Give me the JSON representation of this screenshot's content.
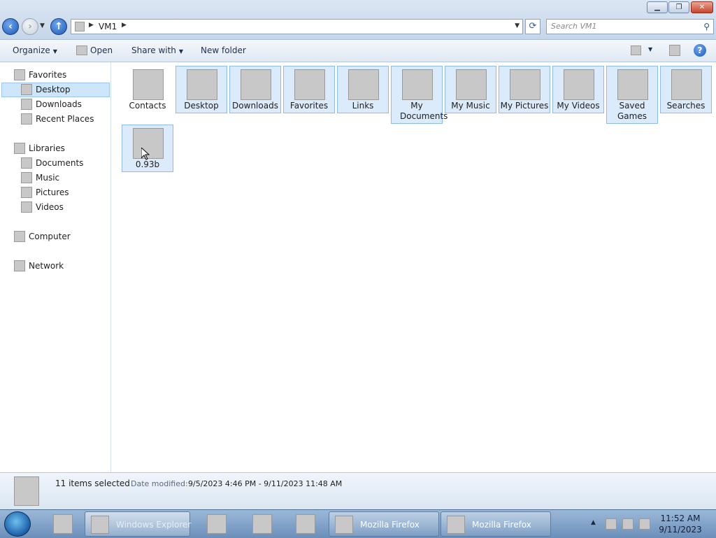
{
  "window": {
    "min_glyph": "▁",
    "max_glyph": "❐",
    "close_glyph": "✕"
  },
  "address": {
    "crumbs": [
      "VM1"
    ],
    "search_placeholder": "Search VM1"
  },
  "toolbar": {
    "organize": "Organize",
    "open": "Open",
    "share_with": "Share with",
    "new_folder": "New folder",
    "help_glyph": "?"
  },
  "sidebar": {
    "favorites": "Favorites",
    "desktop": "Desktop",
    "downloads": "Downloads",
    "recent_places": "Recent Places",
    "libraries": "Libraries",
    "documents": "Documents",
    "music": "Music",
    "pictures": "Pictures",
    "videos": "Videos",
    "computer": "Computer",
    "network": "Network"
  },
  "items": [
    {
      "label": "Contacts",
      "icon": "contacts-folder-icon",
      "selected": false
    },
    {
      "label": "Desktop",
      "icon": "desktop-folder-icon",
      "selected": true
    },
    {
      "label": "Downloads",
      "icon": "downloads-folder-icon",
      "selected": true
    },
    {
      "label": "Favorites",
      "icon": "favorites-folder-icon",
      "selected": true
    },
    {
      "label": "Links",
      "icon": "links-folder-icon",
      "selected": true
    },
    {
      "label": "My Documents",
      "icon": "documents-folder-icon",
      "selected": true
    },
    {
      "label": "My Music",
      "icon": "music-folder-icon",
      "selected": true
    },
    {
      "label": "My Pictures",
      "icon": "pictures-folder-icon",
      "selected": true
    },
    {
      "label": "My Videos",
      "icon": "videos-folder-icon",
      "selected": true
    },
    {
      "label": "Saved Games",
      "icon": "saved-games-folder-icon",
      "selected": true
    },
    {
      "label": "Searches",
      "icon": "searches-folder-icon",
      "selected": true
    },
    {
      "label": "0.93b",
      "icon": "zip-folder-icon",
      "selected": true
    }
  ],
  "details": {
    "count": "11 items selected",
    "date_label": "Date modified:",
    "date_value": "9/5/2023 4:46 PM - 9/11/2023 11:48 AM"
  },
  "taskbar": {
    "explorer": "Windows Explorer",
    "firefox1": "Mozilla Firefox",
    "firefox2": "Mozilla Firefox",
    "time": "11:52 AM",
    "date": "9/11/2023"
  },
  "colors": {
    "selection": "#dcebfc",
    "selection_border": "#8fbbe6",
    "taskbar": "#7d9fc6"
  }
}
